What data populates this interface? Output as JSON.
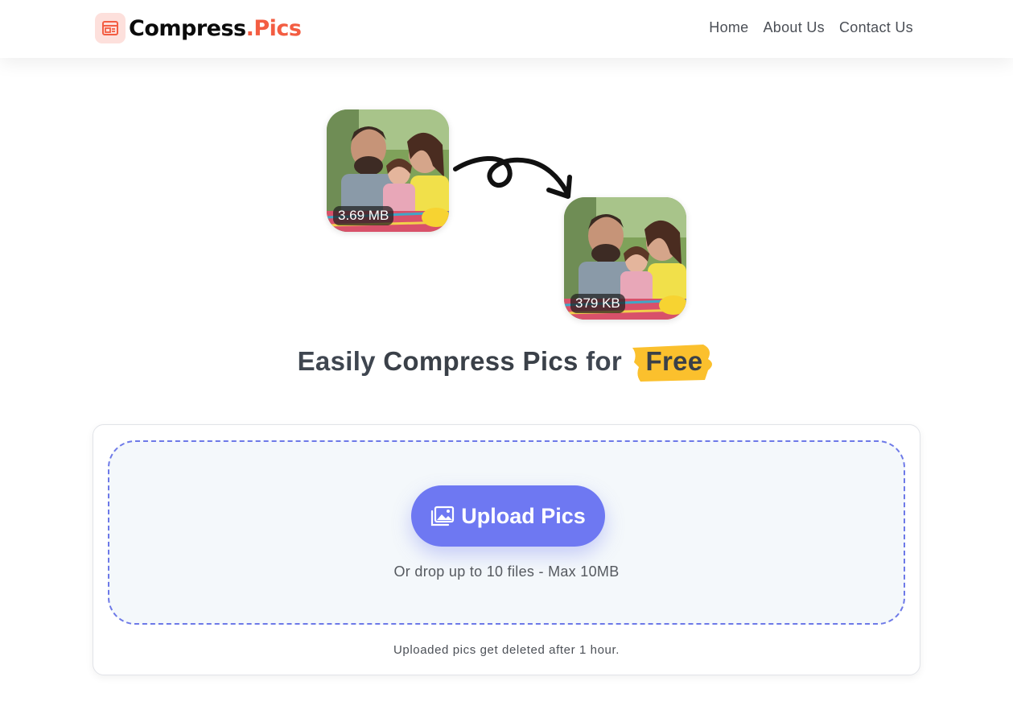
{
  "header": {
    "logo_main": "Compress",
    "logo_accent": ".Pics",
    "nav": [
      {
        "label": "Home"
      },
      {
        "label": "About Us"
      },
      {
        "label": "Contact Us"
      }
    ]
  },
  "hero": {
    "before_size": "3.69 MB",
    "after_size": "379 KB",
    "headline_prefix": "Easily",
    "headline_strong": "Compress Pics",
    "headline_mid": "for",
    "headline_highlight": "Free"
  },
  "upload": {
    "button_label": "Upload Pics",
    "drop_hint": "Or drop up to 10 files - Max 10MB",
    "notice": "Uploaded pics get deleted after 1 hour."
  },
  "colors": {
    "brand_accent": "#f35d42",
    "primary": "#6e78f2",
    "highlight": "#fbc02d"
  },
  "icons": {
    "logo": "image-frame-icon",
    "upload": "images-icon",
    "arrow": "curly-arrow-icon"
  }
}
